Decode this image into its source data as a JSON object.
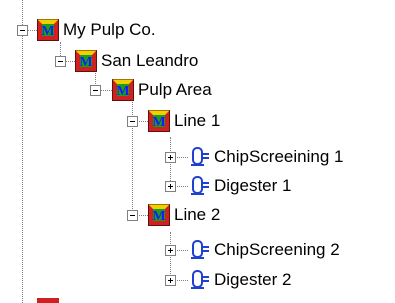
{
  "tree": {
    "nodes": [
      {
        "label": "My Pulp Co.",
        "icon": "plant-m-icon",
        "state": "expanded"
      },
      {
        "label": "San Leandro",
        "icon": "plant-m-icon",
        "state": "expanded"
      },
      {
        "label": "Pulp Area",
        "icon": "plant-m-icon",
        "state": "expanded"
      },
      {
        "label": "Line 1",
        "icon": "plant-m-icon",
        "state": "expanded"
      },
      {
        "label": "ChipScreeining 1",
        "icon": "equipment-icon",
        "state": "collapsed"
      },
      {
        "label": "Digester 1",
        "icon": "equipment-icon",
        "state": "collapsed"
      },
      {
        "label": "Line 2",
        "icon": "plant-m-icon",
        "state": "expanded"
      },
      {
        "label": "ChipScreening 2",
        "icon": "equipment-icon",
        "state": "collapsed"
      },
      {
        "label": "Digester 2",
        "icon": "equipment-icon",
        "state": "collapsed"
      }
    ]
  },
  "colors": {
    "m_letter": "#1a1aff",
    "m_background": "#19a019",
    "cube_red": "#d02020",
    "cube_yellow": "#f0d000",
    "equipment_blue": "#2040d0",
    "tree_line": "#808080"
  }
}
